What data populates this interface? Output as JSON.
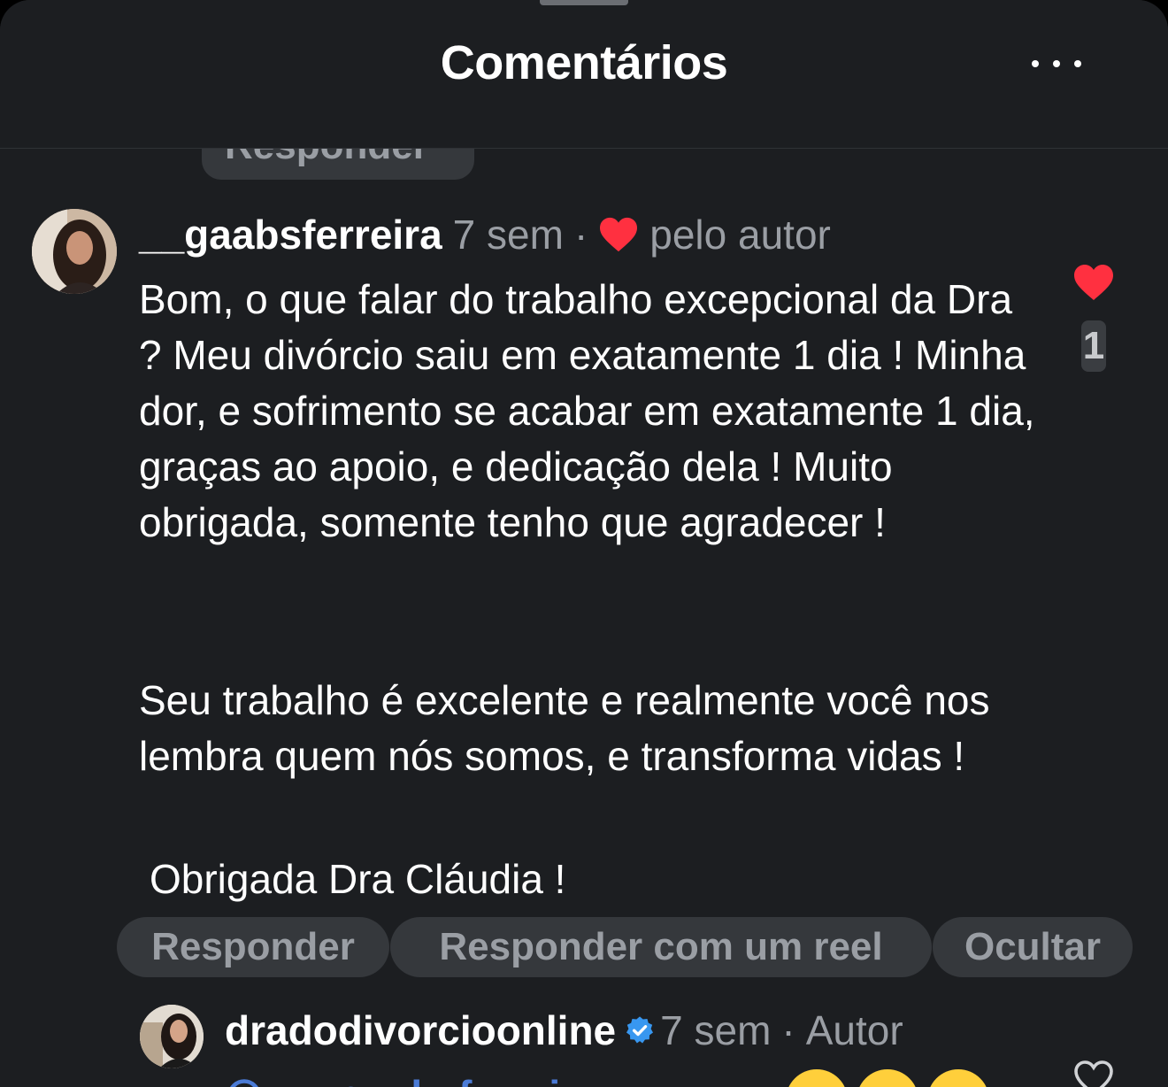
{
  "header": {
    "title": "Comentários",
    "menu_icon": "more-horizontal-icon"
  },
  "previous_reply_label": "Responder",
  "comment": {
    "username": "__gaabsferreira",
    "time": "7 sem",
    "separator": "·",
    "liked_by_author_icon": "heart-filled-icon",
    "liked_by_author_label": "pelo autor",
    "paragraphs": [
      "Bom, o que falar do trabalho excepcional da Dra ? Meu divórcio saiu em exatamente 1 dia ! Minha dor, e sofrimento se acabar em exatamente 1 dia, graças ao apoio, e dedicação dela ! Muito obrigada, somente tenho que agradecer !",
      "Seu trabalho é excelente e realmente você nos lembra quem nós somos, e transforma vidas !",
      "Obrigada Dra Cláudia !"
    ],
    "like_count": "1",
    "actions": {
      "reply": "Responder",
      "reply_reel": "Responder com um reel",
      "hide": "Ocultar"
    }
  },
  "reply": {
    "username": "dradodivorcioonline",
    "verified_icon": "verified-badge-icon",
    "time": "7 sem",
    "separator": "·",
    "role": "Autor",
    "text_partial": "__gaabsferreira awww"
  },
  "colors": {
    "background": "#1c1e21",
    "pill": "#35383c",
    "muted_text": "#9a9ea4",
    "heart": "#ff3040",
    "verified": "#3897f0",
    "mention": "#4b7bd6"
  }
}
